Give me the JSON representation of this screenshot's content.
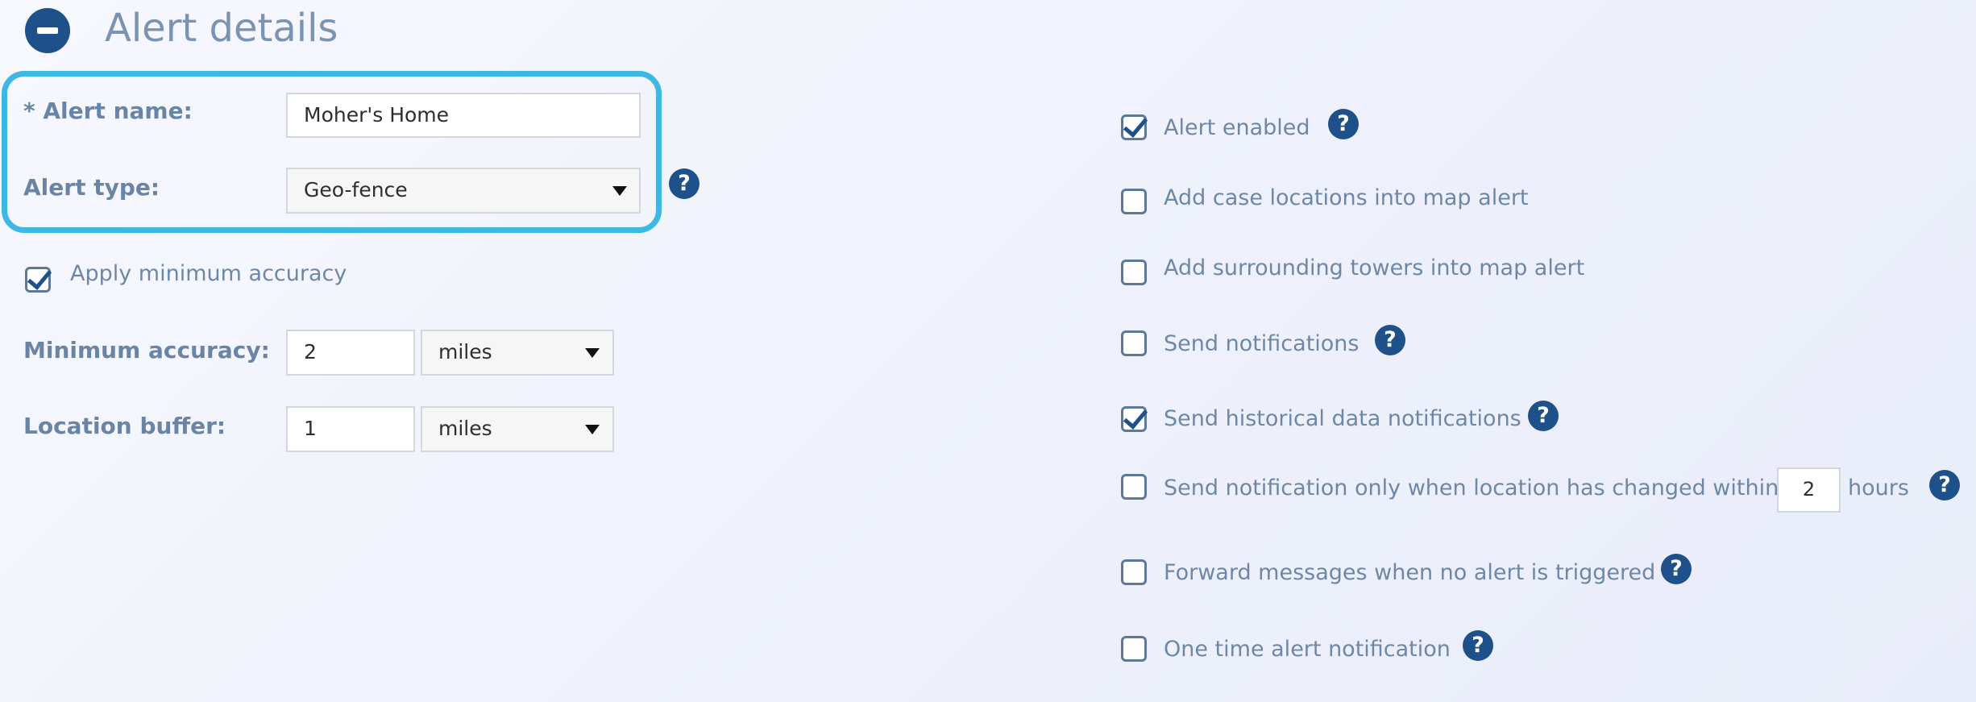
{
  "header": {
    "title": "Alert details",
    "collapse_icon": "minus-circle-icon"
  },
  "form": {
    "alert_name": {
      "label": "* Alert name:",
      "value": "Moher's Home"
    },
    "alert_type": {
      "label": "Alert type:",
      "value": "Geo-fence"
    },
    "apply_min_accuracy": {
      "label": "Apply minimum accuracy",
      "checked": true
    },
    "min_accuracy": {
      "label": "Minimum accuracy:",
      "value": "2",
      "unit": "miles"
    },
    "location_buffer": {
      "label": "Location buffer:",
      "value": "1",
      "unit": "miles"
    }
  },
  "options": [
    {
      "label": "Alert enabled",
      "checked": true,
      "help": true
    },
    {
      "label": "Add case locations into map alert",
      "checked": false,
      "help": false
    },
    {
      "label": "Add surrounding towers into map alert",
      "checked": false,
      "help": false
    },
    {
      "label": "Send notifications",
      "checked": false,
      "help": true
    },
    {
      "label": "Send historical data notifications",
      "checked": true,
      "help": true
    },
    {
      "label": "Send notification only when location has changed within",
      "checked": false,
      "help": true,
      "value": "2",
      "unit": "hours"
    },
    {
      "label": "Forward messages when no alert is triggered",
      "checked": false,
      "help": true
    },
    {
      "label": "One time alert notification",
      "checked": false,
      "help": true
    }
  ],
  "help_glyph": "?",
  "colors": {
    "accent": "#1e5089",
    "highlight": "#3db7e4",
    "label": "#6a84a6"
  }
}
